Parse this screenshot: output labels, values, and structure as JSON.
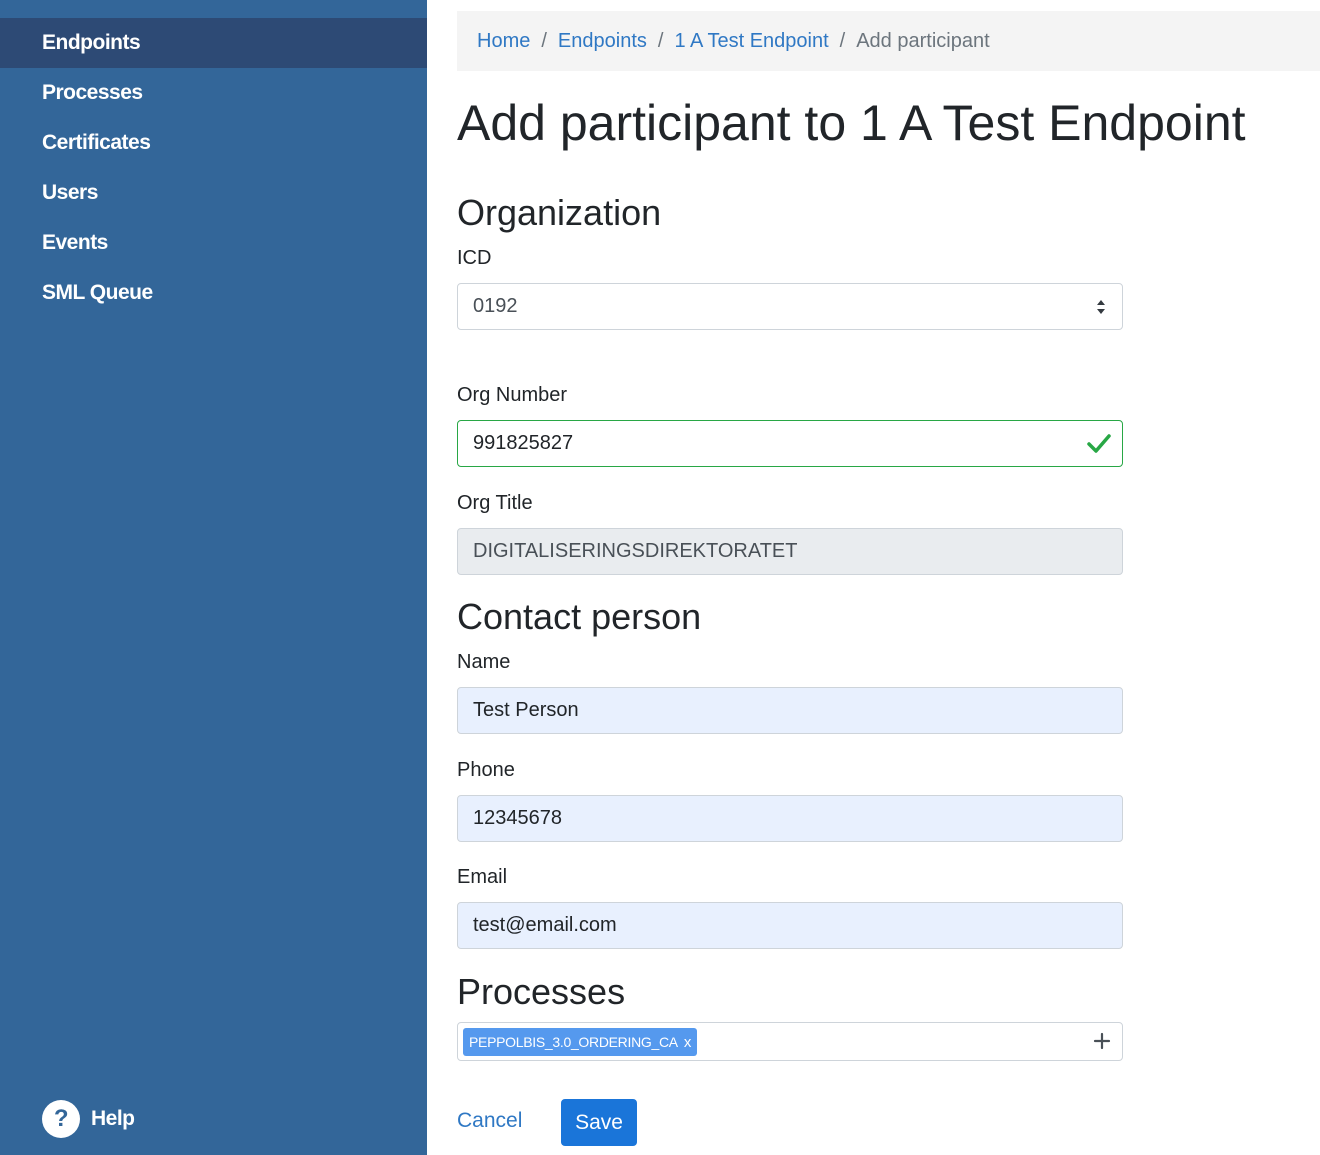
{
  "sidebar": {
    "items": [
      {
        "label": "Endpoints",
        "active": true
      },
      {
        "label": "Processes",
        "active": false
      },
      {
        "label": "Certificates",
        "active": false
      },
      {
        "label": "Users",
        "active": false
      },
      {
        "label": "Events",
        "active": false
      },
      {
        "label": "SML Queue",
        "active": false
      }
    ],
    "help_label": "Help",
    "help_icon": "question-circle-icon"
  },
  "breadcrumb": {
    "items": [
      {
        "label": "Home"
      },
      {
        "label": "Endpoints"
      },
      {
        "label": "1 A Test Endpoint"
      }
    ],
    "separator": "/",
    "current": "Add participant"
  },
  "page_title": "Add participant to 1 A Test Endpoint",
  "organization": {
    "heading": "Organization",
    "icd": {
      "label": "ICD",
      "value": "0192"
    },
    "org_number": {
      "label": "Org Number",
      "value": "991825827",
      "valid": true
    },
    "org_title": {
      "label": "Org Title",
      "value": "DIGITALISERINGSDIREKTORATET",
      "readonly": true
    }
  },
  "contact": {
    "heading": "Contact person",
    "name": {
      "label": "Name",
      "value": "Test Person"
    },
    "phone": {
      "label": "Phone",
      "value": "12345678"
    },
    "email": {
      "label": "Email",
      "value": "test@email.com"
    }
  },
  "processes": {
    "heading": "Processes",
    "tags": [
      {
        "label": "PEPPOLBIS_3.0_ORDERING_CA",
        "remove": "x"
      }
    ],
    "add_icon": "plus-icon"
  },
  "actions": {
    "cancel_label": "Cancel",
    "save_label": "Save"
  },
  "colors": {
    "sidebar_bg": "#336699",
    "sidebar_active_bg": "#2d4a75",
    "link": "#2f78c4",
    "primary_button": "#1a75d9",
    "valid_border": "#28a745",
    "tag_bg": "#5599ee"
  }
}
